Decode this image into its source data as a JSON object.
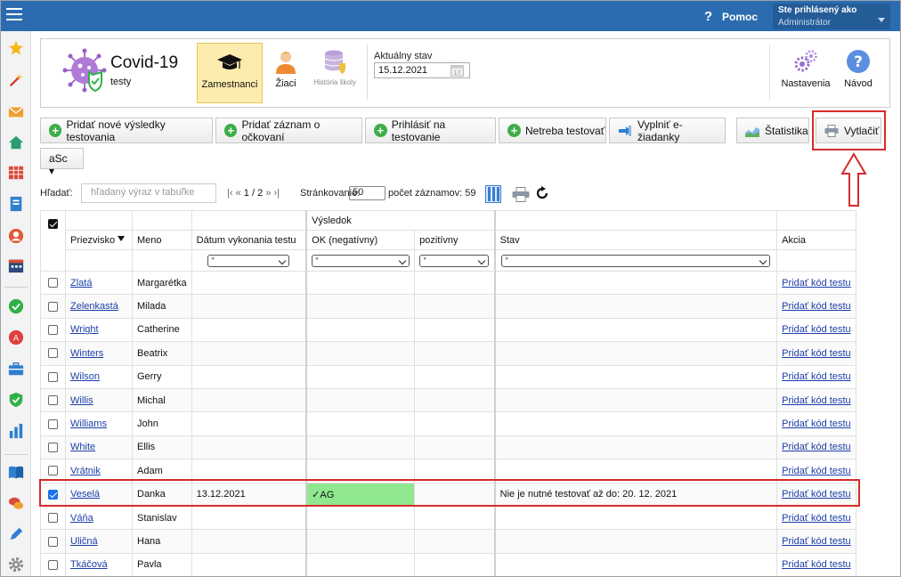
{
  "topbar": {
    "help_label": "Pomoc",
    "user_line1": "Ste prihlásený ako",
    "user_line2": "Administrátor"
  },
  "app": {
    "title": "Covid-19",
    "subtitle": "testy"
  },
  "header_buttons": {
    "zamestnanci": "Zamestnanci",
    "ziaci": "Žiaci",
    "historia": "História školy",
    "nastavenia": "Nastavenia",
    "navod": "Návod"
  },
  "state": {
    "label": "Aktuálny stav",
    "date": "15.12.2021"
  },
  "actions": {
    "add_results": "Pridať nové výsledky testovania",
    "add_vaccination": "Pridať záznam o očkovaní",
    "register_test": "Prihlásiť na testovanie",
    "no_test_needed": "Netreba testovať",
    "fill_request": "Vyplniť e-žiadanky",
    "statistics": "Štatistika",
    "print": "Vytlačiť",
    "asc": "aSc ▾"
  },
  "search": {
    "label": "Hľadať:",
    "placeholder": "hľadaný výraz v tabuľke"
  },
  "pager": {
    "nav_first": "|‹",
    "nav_prev": "«",
    "page_text": "1 / 2",
    "nav_next": "»",
    "nav_last": "›|",
    "paging_label": "Stránkovanie:",
    "page_size": "50",
    "count_text": "počet záznamov: 59"
  },
  "table": {
    "group_header": "Výsledok",
    "columns": {
      "surname": "Priezvisko",
      "name": "Meno",
      "date": "Dátum vykonania testu",
      "ok": "OK (negatívny)",
      "positive": "pozitívny",
      "status": "Stav",
      "action": "Akcia"
    },
    "filter_value": "*",
    "action_link": "Pridať kód testu",
    "rows": [
      {
        "surname": "Zlatá",
        "name": "Margarétka",
        "date": "",
        "ok": "",
        "positive": "",
        "status": "",
        "checked": false
      },
      {
        "surname": "Zelenkastá",
        "name": "Milada",
        "date": "",
        "ok": "",
        "positive": "",
        "status": "",
        "checked": false
      },
      {
        "surname": "Wright",
        "name": "Catherine",
        "date": "",
        "ok": "",
        "positive": "",
        "status": "",
        "checked": false
      },
      {
        "surname": "Winters",
        "name": "Beatrix",
        "date": "",
        "ok": "",
        "positive": "",
        "status": "",
        "checked": false
      },
      {
        "surname": "Wilson",
        "name": "Gerry",
        "date": "",
        "ok": "",
        "positive": "",
        "status": "",
        "checked": false
      },
      {
        "surname": "Willis",
        "name": "Michal",
        "date": "",
        "ok": "",
        "positive": "",
        "status": "",
        "checked": false
      },
      {
        "surname": "Williams",
        "name": "John",
        "date": "",
        "ok": "",
        "positive": "",
        "status": "",
        "checked": false
      },
      {
        "surname": "White",
        "name": "Ellis",
        "date": "",
        "ok": "",
        "positive": "",
        "status": "",
        "checked": false
      },
      {
        "surname": "Vrátnik",
        "name": "Adam",
        "date": "",
        "ok": "",
        "positive": "",
        "status": "",
        "checked": false
      },
      {
        "surname": "Veselá",
        "name": "Danka",
        "date": "13.12.2021",
        "ok": "✓AG",
        "positive": "",
        "status": "Nie je nutné testovať až do: 20. 12. 2021",
        "checked": true
      },
      {
        "surname": "Váňa",
        "name": "Stanislav",
        "date": "",
        "ok": "",
        "positive": "",
        "status": "",
        "checked": false
      },
      {
        "surname": "Uličná",
        "name": "Hana",
        "date": "",
        "ok": "",
        "positive": "",
        "status": "",
        "checked": false
      },
      {
        "surname": "Tkáčová",
        "name": "Pavla",
        "date": "",
        "ok": "",
        "positive": "",
        "status": "",
        "checked": false
      }
    ]
  },
  "colors": {
    "topbar": "#2b6cb0",
    "ok_cell": "#8fe88f",
    "annotation_red": "#d62b2b",
    "highlight_button": "#fcecae"
  }
}
